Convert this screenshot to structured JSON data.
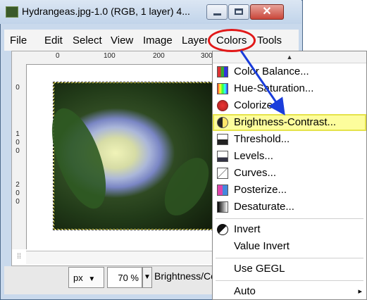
{
  "window": {
    "title": "Hydrangeas.jpg-1.0 (RGB, 1 layer) 4...",
    "close_glyph": "✕"
  },
  "menubar": {
    "file": "File",
    "edit": "Edit",
    "select": "Select",
    "view": "View",
    "image": "Image",
    "layer": "Layer",
    "colors": "Colors",
    "tools": "Tools"
  },
  "rulers": {
    "h_labels": [
      "0",
      "100",
      "200",
      "300"
    ],
    "v_labels": [
      "0",
      "100",
      "200"
    ]
  },
  "status": {
    "unit": "px",
    "unit_arrow": "▼",
    "zoom": "70 %",
    "zoom_arrow": "▼",
    "message": "Brightness/Co"
  },
  "colors_menu": {
    "scroll_up_glyph": "▲",
    "items": [
      {
        "label": "Color Balance...",
        "icon": "color-balance-icon"
      },
      {
        "label": "Hue-Saturation...",
        "icon": "hue-saturation-icon"
      },
      {
        "label": "Colorize...",
        "icon": "colorize-icon"
      },
      {
        "label": "Brightness-Contrast...",
        "icon": "brightness-contrast-icon",
        "highlighted": true
      },
      {
        "label": "Threshold...",
        "icon": "threshold-icon"
      },
      {
        "label": "Levels...",
        "icon": "levels-icon"
      },
      {
        "label": "Curves...",
        "icon": "curves-icon"
      },
      {
        "label": "Posterize...",
        "icon": "posterize-icon"
      },
      {
        "label": "Desaturate...",
        "icon": "desaturate-icon"
      },
      {
        "label": "Invert",
        "icon": "invert-icon"
      },
      {
        "label": "Value Invert",
        "icon": ""
      },
      {
        "label": "Use GEGL",
        "icon": ""
      },
      {
        "label": "Auto",
        "icon": "",
        "submenu": "▸"
      }
    ]
  },
  "colors": {
    "highlight_fill": "#fdfd9c",
    "highlight_border": "#e5e34b",
    "annotation_red": "#e11818",
    "annotation_blue": "#1a3ddb"
  }
}
